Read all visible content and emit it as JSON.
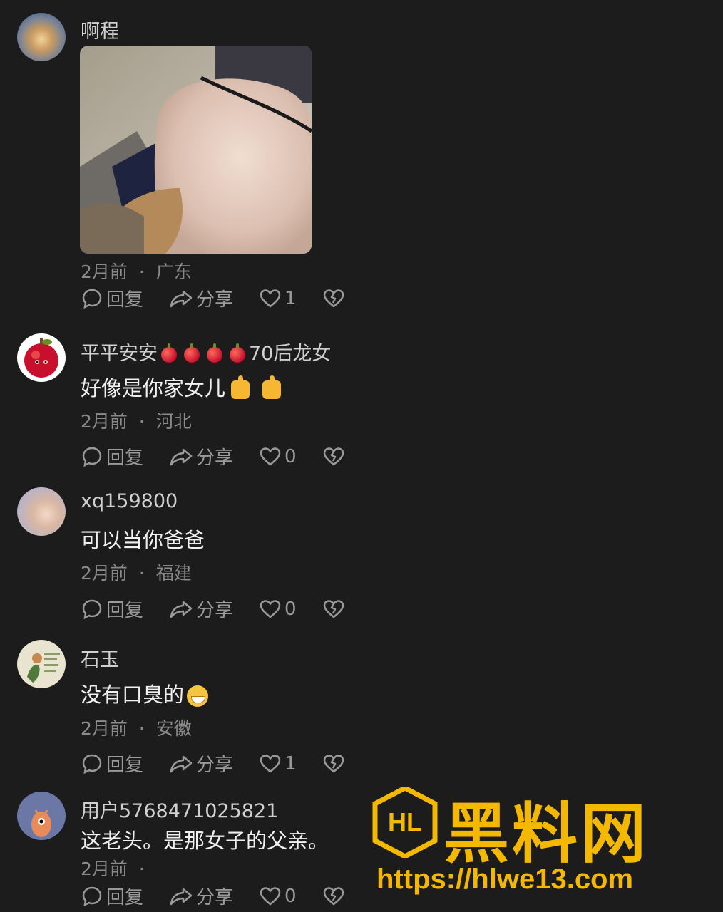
{
  "comments": [
    {
      "username": "啊程",
      "text": "",
      "time": "2月前",
      "location": "广东",
      "reply": "回复",
      "share": "分享",
      "likes": "1"
    },
    {
      "username": "平平安安",
      "username_suffix": "70后龙女",
      "text": "好像是你家女儿",
      "time": "2月前",
      "location": "河北",
      "reply": "回复",
      "share": "分享",
      "likes": "0"
    },
    {
      "username": "xq159800",
      "text": "可以当你爸爸",
      "time": "2月前",
      "location": "福建",
      "reply": "回复",
      "share": "分享",
      "likes": "0"
    },
    {
      "username": "石玉",
      "text": "没有口臭的",
      "time": "2月前",
      "location": "安徽",
      "reply": "回复",
      "share": "分享",
      "likes": "1"
    },
    {
      "username": "用户5768471025821",
      "text": "这老头。是那女子的父亲。",
      "time": "2月前",
      "location": "",
      "reply": "回复",
      "share": "分享",
      "likes": "0"
    }
  ],
  "separator": "·",
  "watermark": {
    "brand": "黑料网",
    "url": "https://hlwe13.com",
    "logo": "HL"
  },
  "colors": {
    "background": "#1c1c1c",
    "text": "#e6e6e6",
    "muted": "#8a8a8a",
    "watermark": "#f5b800"
  },
  "icons": [
    "comment-icon",
    "share-icon",
    "heart-icon",
    "broken-heart-icon"
  ]
}
